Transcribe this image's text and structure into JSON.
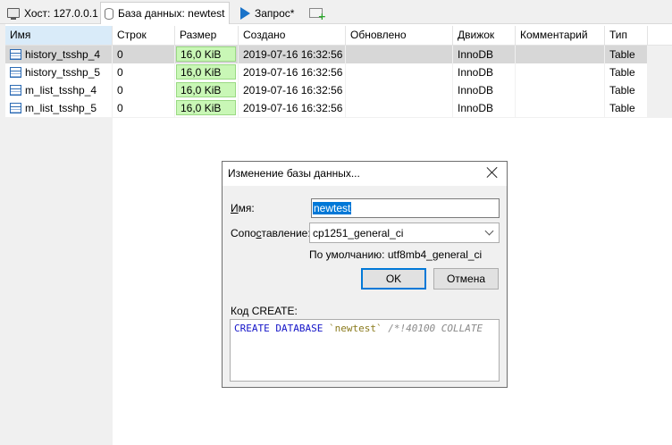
{
  "tabs": [
    {
      "label": "Хост: 127.0.0.1",
      "icon": "host-icon"
    },
    {
      "label": "База данных: newtest",
      "icon": "database-icon"
    },
    {
      "label": "Запрос*",
      "icon": "play-icon"
    },
    {
      "label": "",
      "icon": "new-query-tab-icon"
    }
  ],
  "grid": {
    "columns": [
      "Имя",
      "Строк",
      "Размер",
      "Создано",
      "Обновлено",
      "Движок",
      "Комментарий",
      "Тип"
    ],
    "rows": [
      {
        "name": "history_tsshp_4",
        "rows": "0",
        "size": "16,0 KiB",
        "created": "2019-07-16 16:32:56",
        "updated": "",
        "engine": "InnoDB",
        "comment": "",
        "type": "Table"
      },
      {
        "name": "history_tsshp_5",
        "rows": "0",
        "size": "16,0 KiB",
        "created": "2019-07-16 16:32:56",
        "updated": "",
        "engine": "InnoDB",
        "comment": "",
        "type": "Table"
      },
      {
        "name": "m_list_tsshp_4",
        "rows": "0",
        "size": "16,0 KiB",
        "created": "2019-07-16 16:32:56",
        "updated": "",
        "engine": "InnoDB",
        "comment": "",
        "type": "Table"
      },
      {
        "name": "m_list_tsshp_5",
        "rows": "0",
        "size": "16,0 KiB",
        "created": "2019-07-16 16:32:56",
        "updated": "",
        "engine": "InnoDB",
        "comment": "",
        "type": "Table"
      }
    ],
    "selected_row": 0,
    "size_fill": 1.0
  },
  "dialog": {
    "title": "Изменение базы данных...",
    "name_label_accel": "И",
    "name_label_rest": "мя:",
    "name_value": "newtest",
    "collation_label_prefix": "Сопо",
    "collation_label_accel": "с",
    "collation_label_rest": "тавление:",
    "collation_value": "cp1251_general_ci",
    "default_note": "По умолчанию: utf8mb4_general_ci",
    "ok_label": "OK",
    "cancel_label": "Отмена",
    "create_code_label": "Код CREATE:",
    "create_code": {
      "kw": "CREATE DATABASE",
      "ident": "`newtest`",
      "comment": "/*!40100 COLLATE"
    }
  },
  "colors": {
    "accent": "#0078d7",
    "size_bar": "#c9f7b6",
    "selected_row": "#d7d7d7",
    "keyword": "#1414c8"
  }
}
